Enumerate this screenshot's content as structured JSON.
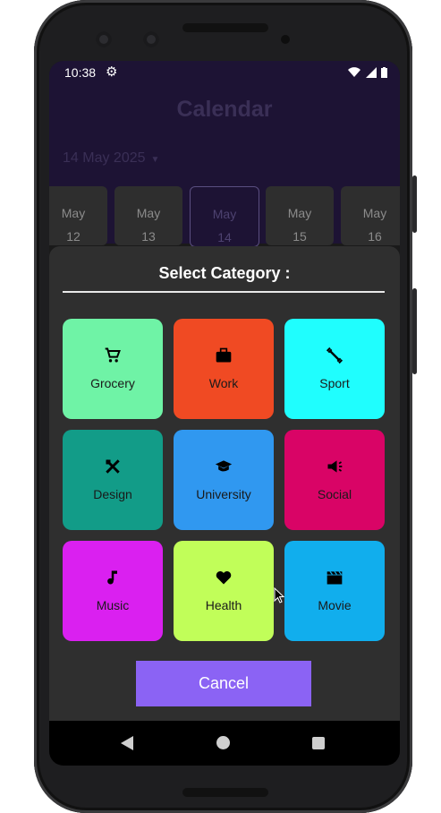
{
  "status_bar": {
    "time": "10:38"
  },
  "app_bar": {
    "title": "Calendar",
    "selected_date": "14 May 2025"
  },
  "day_strip": [
    {
      "month": "May",
      "day": "12",
      "selected": false
    },
    {
      "month": "May",
      "day": "13",
      "selected": false
    },
    {
      "month": "May",
      "day": "14",
      "selected": true
    },
    {
      "month": "May",
      "day": "15",
      "selected": false
    },
    {
      "month": "May",
      "day": "16",
      "selected": false
    }
  ],
  "dialog": {
    "title": "Select Category :",
    "categories": [
      {
        "label": "Grocery",
        "icon": "cart-icon",
        "color": "#6ff3a6"
      },
      {
        "label": "Work",
        "icon": "briefcase-icon",
        "color": "#f04a23"
      },
      {
        "label": "Sport",
        "icon": "dumbbell-icon",
        "color": "#1ffefe"
      },
      {
        "label": "Design",
        "icon": "design-icon",
        "color": "#129c88"
      },
      {
        "label": "University",
        "icon": "graduation-cap-icon",
        "color": "#3098f0"
      },
      {
        "label": "Social",
        "icon": "megaphone-icon",
        "color": "#d90466"
      },
      {
        "label": "Music",
        "icon": "music-note-icon",
        "color": "#da20f0"
      },
      {
        "label": "Health",
        "icon": "heart-icon",
        "color": "#c1fe59"
      },
      {
        "label": "Movie",
        "icon": "clapperboard-icon",
        "color": "#11aeed"
      }
    ],
    "cancel_label": "Cancel"
  },
  "colors": {
    "accent": "#8b63f4",
    "app_bar": "#1d1334",
    "sheet": "#2f2f2f"
  }
}
